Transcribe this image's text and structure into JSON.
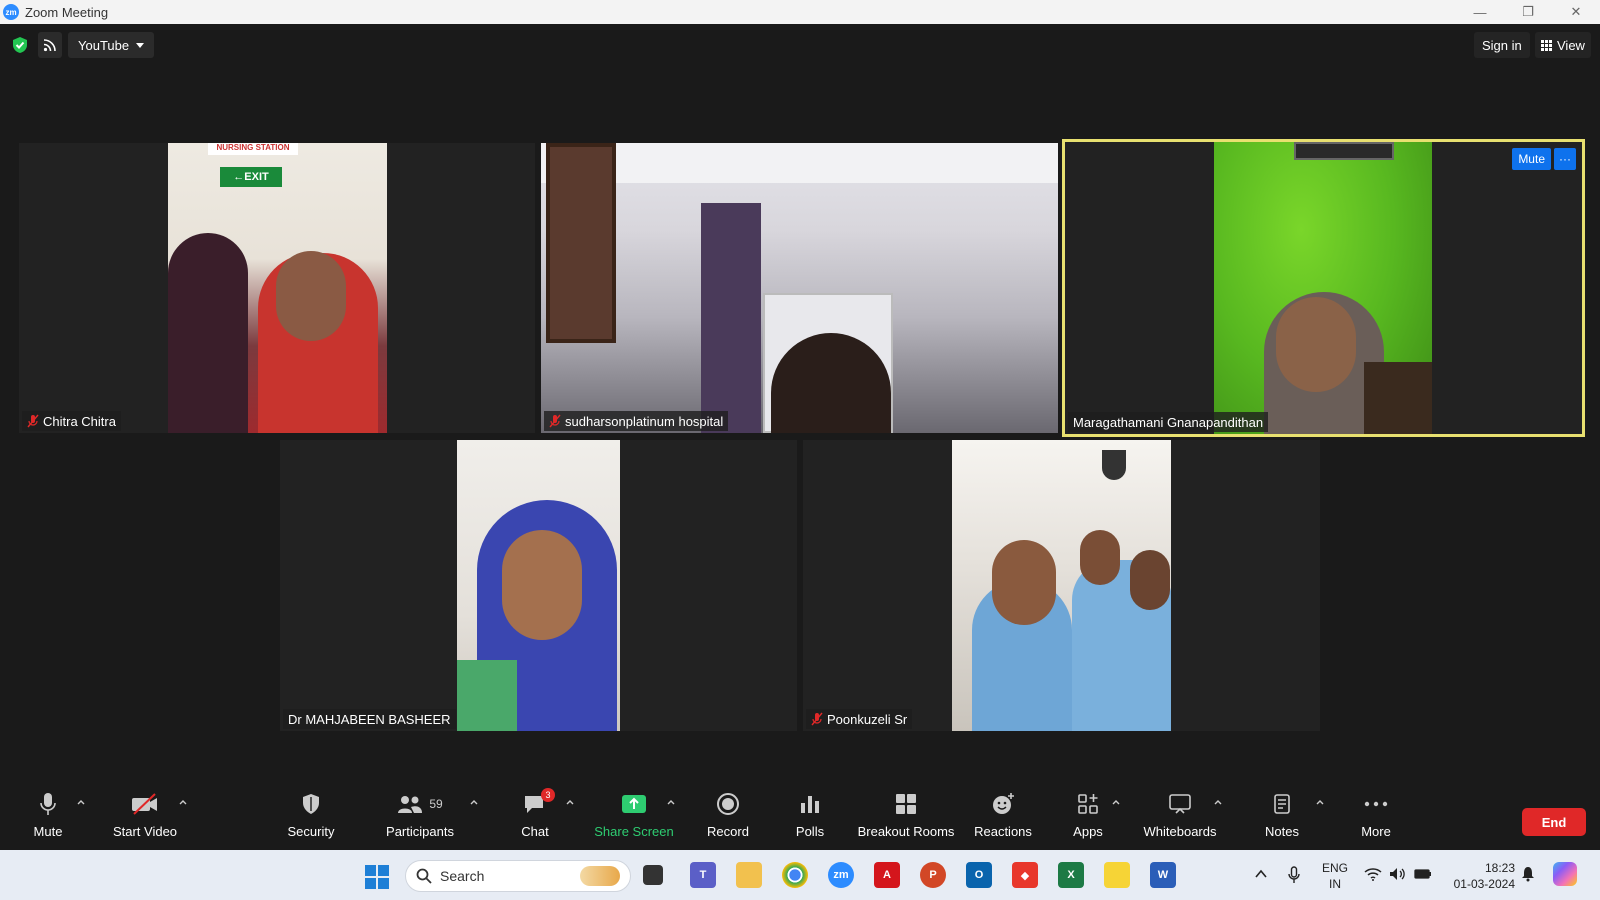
{
  "window": {
    "title": "Zoom Meeting"
  },
  "topbar": {
    "source_label": "YouTube",
    "sign_in": "Sign in",
    "view": "View"
  },
  "tiles": [
    {
      "name": "Chitra Chitra",
      "muted": true
    },
    {
      "name": "sudharsonplatinum hospital",
      "muted": true
    },
    {
      "name": "Maragathamani Gnanapandithan",
      "muted": false,
      "active": true,
      "mute_button": "Mute",
      "more_button": "···"
    },
    {
      "name": "Dr MAHJABEEN BASHEER",
      "muted": false
    },
    {
      "name": "Poonkuzeli Sr",
      "muted": true
    }
  ],
  "toolbar": {
    "mute": "Mute",
    "start_video": "Start Video",
    "security": "Security",
    "participants": "Participants",
    "participants_count": "59",
    "chat": "Chat",
    "chat_badge": "3",
    "share_screen": "Share Screen",
    "record": "Record",
    "polls": "Polls",
    "breakout_rooms": "Breakout Rooms",
    "reactions": "Reactions",
    "apps": "Apps",
    "whiteboards": "Whiteboards",
    "notes": "Notes",
    "more": "More",
    "end": "End"
  },
  "taskbar": {
    "search_placeholder": "Search",
    "lang_top": "ENG",
    "lang_bottom": "IN",
    "time": "18:23",
    "date": "01-03-2024"
  },
  "colors": {
    "accent": "#0e72ed",
    "active_border": "#e8e070",
    "end_red": "#e02828",
    "share_green": "#2ecc71"
  }
}
